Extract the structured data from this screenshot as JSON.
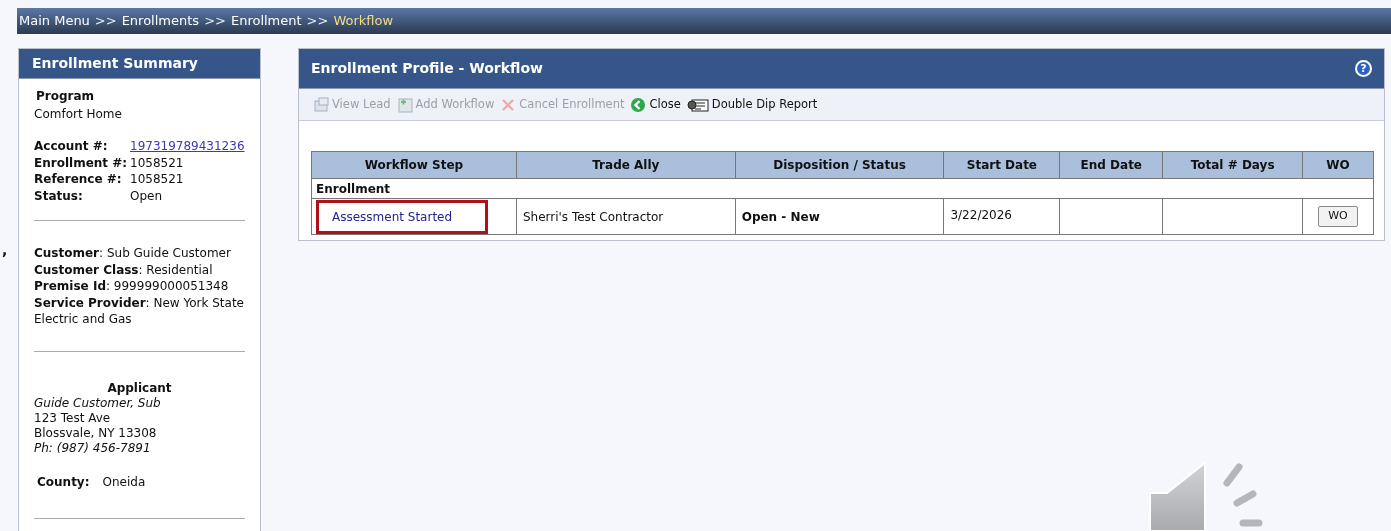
{
  "breadcrumb": [
    {
      "label": "Main Menu",
      "current": false
    },
    {
      "label": "Enrollments",
      "current": false
    },
    {
      "label": "Enrollment",
      "current": false
    },
    {
      "label": "Workflow",
      "current": true
    }
  ],
  "breadcrumb_separator": ">>",
  "stray_mark": ",",
  "summary": {
    "title": "Enrollment Summary",
    "program_label": "Program",
    "program": "Comfort Home",
    "ids": [
      {
        "label": "Account #:",
        "value": "197319789431236",
        "kind": "link"
      },
      {
        "label": "Enrollment #:",
        "value": "1058521",
        "kind": "text"
      },
      {
        "label": "Reference #:",
        "value": "1058521",
        "kind": "text"
      },
      {
        "label": "Status:",
        "value": "Open",
        "kind": "text"
      }
    ],
    "customer": [
      "**Customer**: Sub Guide Customer",
      "**Customer Class**: Residential",
      "**Premise Id**: 999999000051348",
      "**Service Provider**: New York State Electric and Gas"
    ],
    "applicant": {
      "title": "Applicant",
      "name": "Guide Customer, Sub",
      "street": "123 Test Ave",
      "city": "Blossvale, NY 13308",
      "phone": "Ph: (987) 456-7891"
    },
    "county_label": "County:",
    "county": "Oneida"
  },
  "profile": {
    "title": "Enrollment Profile - Workflow",
    "help_glyph": "?",
    "toolbar": [
      {
        "label": "View Lead",
        "disabled": true
      },
      {
        "label": "Add Workflow",
        "disabled": true
      },
      {
        "label": "Cancel Enrollment",
        "disabled": true
      },
      {
        "label": "Close",
        "disabled": false
      },
      {
        "label": "Double Dip Report",
        "disabled": false
      }
    ],
    "table": {
      "columns": [
        "Workflow Step",
        "Trade Ally",
        "Disposition / Status",
        "Start Date",
        "End Date",
        "Total # Days",
        "WO"
      ],
      "group": "Enrollment",
      "rows": [
        {
          "step": "Assessment Started",
          "highlighted": true,
          "trade_ally": "Sherri's Test Contractor",
          "status": "Open - New",
          "start_date": "3/22/2026",
          "wo_button": "WO"
        }
      ]
    }
  }
}
